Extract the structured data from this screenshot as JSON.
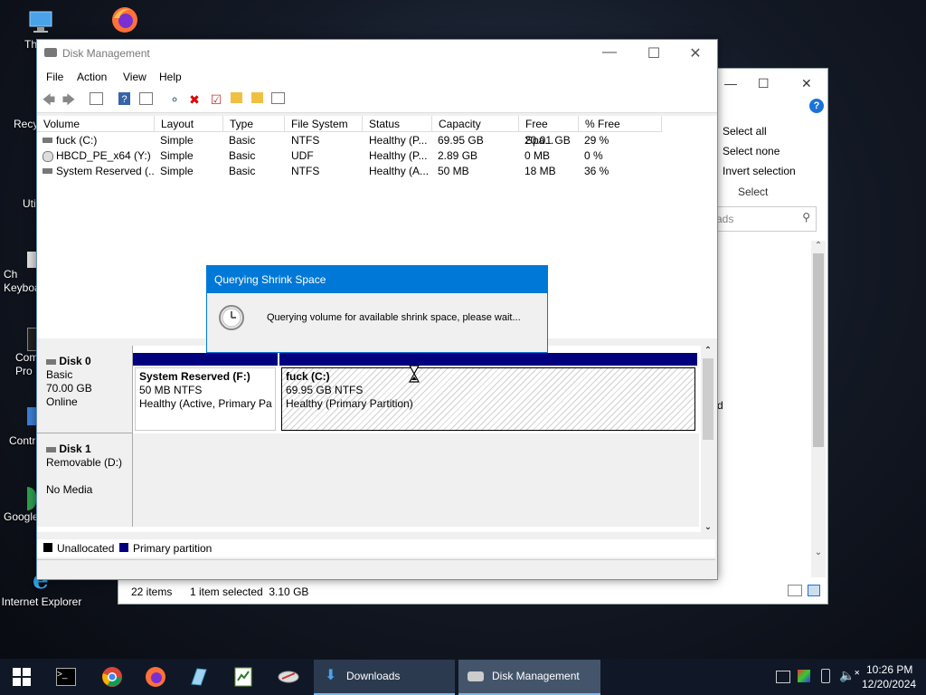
{
  "desktop": {
    "icons": [
      {
        "label": "Th",
        "icon": "this-pc-icon"
      },
      {
        "label": "",
        "icon": "firefox-icon"
      },
      {
        "label": "Recy",
        "icon": "recycle-bin-icon"
      },
      {
        "label": "Uti",
        "icon": "folder-icon"
      },
      {
        "label": "Ch\nKeyboa",
        "icon": "keyboard-icon"
      },
      {
        "label": "Com\nPro",
        "icon": "cmd-icon"
      },
      {
        "label": "Contr",
        "icon": "control-panel-icon"
      },
      {
        "label": "Google",
        "icon": "chrome-icon"
      },
      {
        "label": "Internet Explorer",
        "icon": "ie-icon"
      }
    ]
  },
  "explorer": {
    "select_all": "Select all",
    "select_none": "Select none",
    "invert_selection": "Invert selection",
    "select_group": "Select",
    "search_placeholder": "ads",
    "status_items": "22 items",
    "status_selected": "1 item selected  3.10 GB",
    "partial_d": "d"
  },
  "disk_mgmt": {
    "title": "Disk Management",
    "menu": [
      "File",
      "Action",
      "View",
      "Help"
    ],
    "columns": [
      "Volume",
      "Layout",
      "Type",
      "File System",
      "Status",
      "Capacity",
      "Free Spa...",
      "% Free"
    ],
    "rows": [
      [
        "fuck (C:)",
        "Simple",
        "Basic",
        "NTFS",
        "Healthy (P...",
        "69.95 GB",
        "20.01 GB",
        "29 %"
      ],
      [
        "HBCD_PE_x64 (Y:)",
        "Simple",
        "Basic",
        "UDF",
        "Healthy (P...",
        "2.89 GB",
        "0 MB",
        "0 %"
      ],
      [
        "System Reserved (...",
        "Simple",
        "Basic",
        "NTFS",
        "Healthy (A...",
        "50 MB",
        "18 MB",
        "36 %"
      ]
    ],
    "disk0": {
      "name": "Disk 0",
      "type": "Basic",
      "size": "70.00 GB",
      "state": "Online",
      "partitions": [
        {
          "name": "System Reserved  (F:)",
          "size": "50 MB NTFS",
          "status": "Healthy (Active, Primary Pa"
        },
        {
          "name": "fuck  (C:)",
          "size": "69.95 GB NTFS",
          "status": "Healthy (Primary Partition)"
        }
      ]
    },
    "disk1": {
      "name": "Disk 1",
      "type": "Removable (D:)",
      "state": "No Media"
    },
    "legend": {
      "unallocated": "Unallocated",
      "primary": "Primary partition",
      "unallocated_color": "#000000",
      "primary_color": "#00007f"
    }
  },
  "dialog": {
    "title": "Querying Shrink Space",
    "message": "Querying volume for available shrink space, please wait..."
  },
  "taskbar": {
    "apps": [
      {
        "label": "Downloads",
        "icon": "downloads-folder-icon"
      },
      {
        "label": "Disk Management",
        "icon": "disk-management-icon"
      }
    ],
    "time": "10:26 PM",
    "date": "12/20/2024"
  }
}
